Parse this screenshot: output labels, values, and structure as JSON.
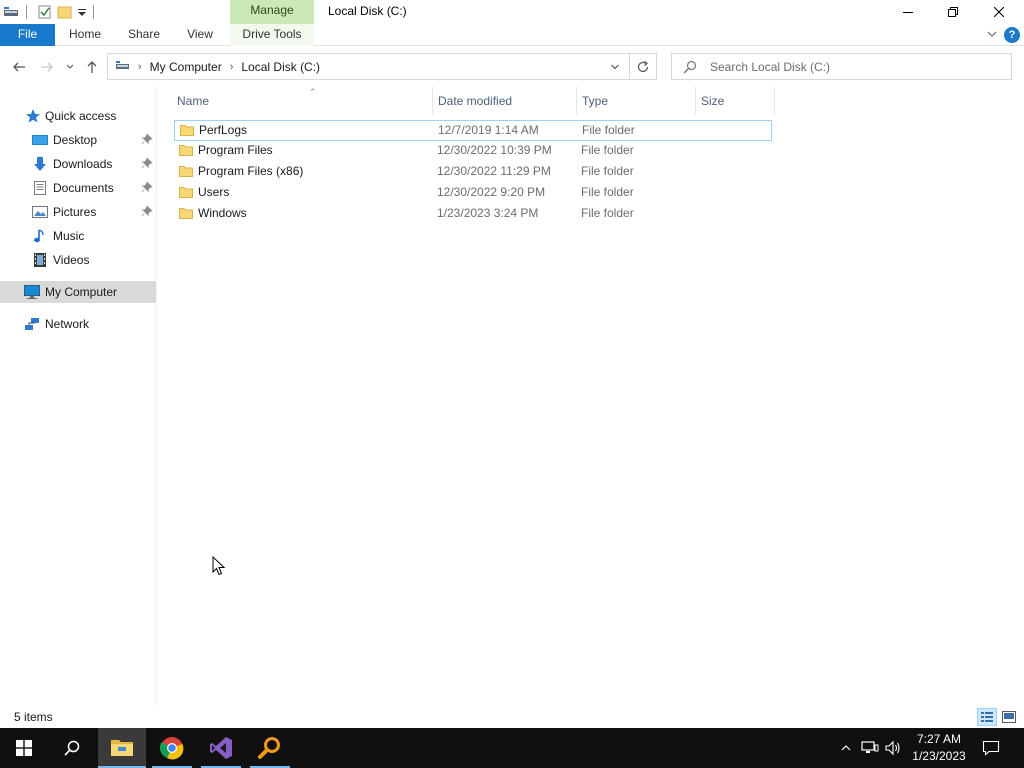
{
  "window": {
    "title": "Local Disk (C:)",
    "context_tab": "Manage",
    "context_subtab": "Drive Tools"
  },
  "ribbon": {
    "tabs": [
      "File",
      "Home",
      "Share",
      "View",
      "Drive Tools"
    ]
  },
  "address": {
    "crumbs": [
      "My Computer",
      "Local Disk (C:)"
    ],
    "search_placeholder": "Search Local Disk (C:)"
  },
  "nav": {
    "quick_access": "Quick access",
    "items": [
      {
        "label": "Desktop",
        "pinned": true
      },
      {
        "label": "Downloads",
        "pinned": true
      },
      {
        "label": "Documents",
        "pinned": true
      },
      {
        "label": "Pictures",
        "pinned": true
      },
      {
        "label": "Music",
        "pinned": false
      },
      {
        "label": "Videos",
        "pinned": false
      }
    ],
    "my_computer": "My Computer",
    "network": "Network"
  },
  "columns": {
    "name": "Name",
    "date": "Date modified",
    "type": "Type",
    "size": "Size"
  },
  "files": [
    {
      "name": "PerfLogs",
      "date": "12/7/2019 1:14 AM",
      "type": "File folder"
    },
    {
      "name": "Program Files",
      "date": "12/30/2022 10:39 PM",
      "type": "File folder"
    },
    {
      "name": "Program Files (x86)",
      "date": "12/30/2022 11:29 PM",
      "type": "File folder"
    },
    {
      "name": "Users",
      "date": "12/30/2022 9:20 PM",
      "type": "File folder"
    },
    {
      "name": "Windows",
      "date": "1/23/2023 3:24 PM",
      "type": "File folder"
    }
  ],
  "status": {
    "item_count": "5 items"
  },
  "taskbar": {
    "time": "7:27 AM",
    "date": "1/23/2023",
    "apps": [
      "windows-start-icon",
      "search-icon",
      "file-explorer-icon",
      "chrome-icon",
      "visual-studio-icon",
      "magnifier-app-icon"
    ]
  },
  "colors": {
    "accent": "#1979ca",
    "manage_tab": "#cde8b8",
    "folder": "#f8d775",
    "selection_border": "#99d1ff",
    "taskbar": "#101010"
  }
}
